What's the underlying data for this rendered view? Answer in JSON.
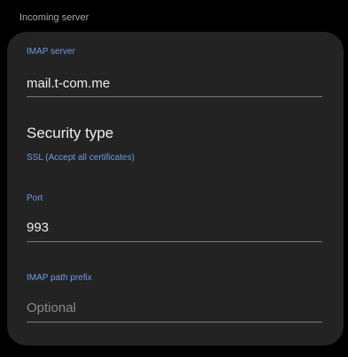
{
  "section": {
    "header": "Incoming server"
  },
  "imap_server": {
    "label": "IMAP server",
    "value": "mail.t-com.me"
  },
  "security_type": {
    "title": "Security type",
    "value": "SSL (Accept all certificates)"
  },
  "port": {
    "label": "Port",
    "value": "993"
  },
  "imap_path_prefix": {
    "label": "IMAP path prefix",
    "placeholder": "Optional",
    "value": ""
  },
  "colors": {
    "accent": "#6f9be8",
    "card_background": "#232323",
    "page_background": "#000000"
  }
}
